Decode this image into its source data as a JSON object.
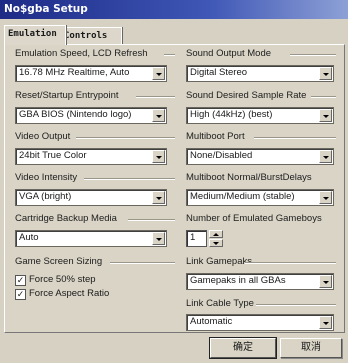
{
  "window": {
    "title": "No$gba Setup"
  },
  "tabs": [
    {
      "label": "Emulation",
      "active": true
    },
    {
      "label": "Controls",
      "active": false
    }
  ],
  "left": {
    "emu_speed": {
      "label": "Emulation Speed, LCD Refresh",
      "value": "16.78 MHz Realtime, Auto"
    },
    "reset": {
      "label": "Reset/Startup Entrypoint",
      "value": "GBA BIOS (Nintendo logo)"
    },
    "video_output": {
      "label": "Video Output",
      "value": "24bit True Color"
    },
    "video_intensity": {
      "label": "Video Intensity",
      "value": "VGA (bright)"
    },
    "backup": {
      "label": "Cartridge Backup Media",
      "value": "Auto"
    },
    "sizing": {
      "label": "Game Screen Sizing",
      "force_50": {
        "label": "Force 50% step",
        "checked": true,
        "mark": "✓"
      },
      "force_aspect": {
        "label": "Force Aspect Ratio",
        "checked": true,
        "mark": "✓"
      }
    }
  },
  "right": {
    "sound_mode": {
      "label": "Sound Output Mode",
      "value": "Digital Stereo"
    },
    "sample_rate": {
      "label": "Sound Desired Sample Rate",
      "value": "High (44kHz) (best)"
    },
    "multiboot_port": {
      "label": "Multiboot Port",
      "value": "None/Disabled"
    },
    "multiboot_delays": {
      "label": "Multiboot Normal/BurstDelays",
      "value": "Medium/Medium (stable)"
    },
    "num_gameboys": {
      "label": "Number of Emulated Gameboys",
      "value": "1"
    },
    "link_gamepaks": {
      "label": "Link Gamepaks",
      "value": "Gamepaks in all GBAs"
    },
    "link_cable": {
      "label": "Link Cable Type",
      "value": "Automatic"
    }
  },
  "buttons": {
    "ok": "确定",
    "cancel": "取消"
  }
}
